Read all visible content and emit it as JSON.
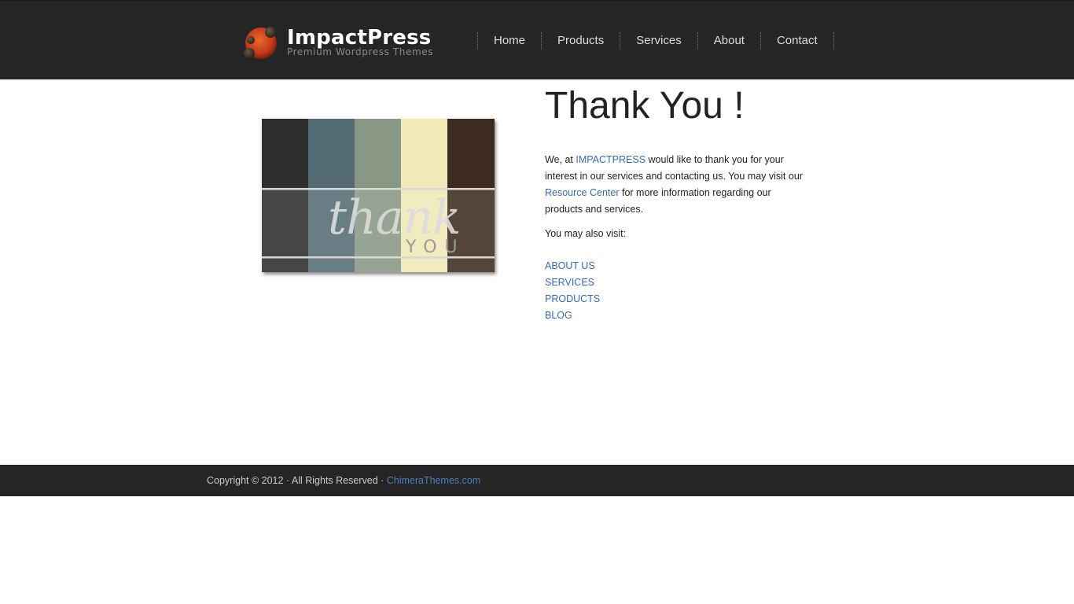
{
  "header": {
    "logo_title": "ImpactPress",
    "logo_tagline": "Premium Wordpress Themes",
    "nav": [
      "Home",
      "Products",
      "Services",
      "About",
      "Contact"
    ]
  },
  "card": {
    "script_text": "thank",
    "caps_text": "YOU",
    "stripe_colors": [
      "#2b2e2b",
      "#546b73",
      "#889884",
      "#f1e9b7",
      "#3d2b1f"
    ]
  },
  "main": {
    "title": "Thank You !",
    "intro_prefix": "We, at ",
    "intro_brand": "IMPACTPRESS",
    "intro_middle": " would like to thank you for your interest in our services and contacting us. You may visit our ",
    "intro_link": "Resource Center",
    "intro_suffix": " for more information regarding our products and services.",
    "also_visit": "You may also visit:",
    "visit_links": [
      "ABOUT US",
      "SERVICES",
      "PRODUCTS",
      "BLOG"
    ]
  },
  "footer": {
    "copyright": "Copyright © 2012 · All Rights Reserved · ",
    "link": "ChimeraThemes.com"
  },
  "colors": {
    "header_bg": "#252525",
    "link": "#3a6aa8"
  }
}
